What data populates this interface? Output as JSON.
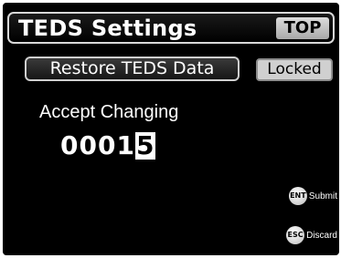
{
  "header": {
    "title": "TEDS Settings",
    "top_label": "TOP"
  },
  "actions": {
    "restore_label": "Restore TEDS Data",
    "locked_label": "Locked"
  },
  "accept": {
    "label": "Accept Changing",
    "value_prefix": "0001",
    "value_cursor_digit": "5"
  },
  "hints": {
    "enter_key": "ENT",
    "enter_action": "Submit",
    "escape_key": "ESC",
    "escape_action": "Discard"
  },
  "colors": {
    "screen_background": "#000000",
    "button_gray": "#d0d0d0",
    "text": "#ffffff"
  }
}
